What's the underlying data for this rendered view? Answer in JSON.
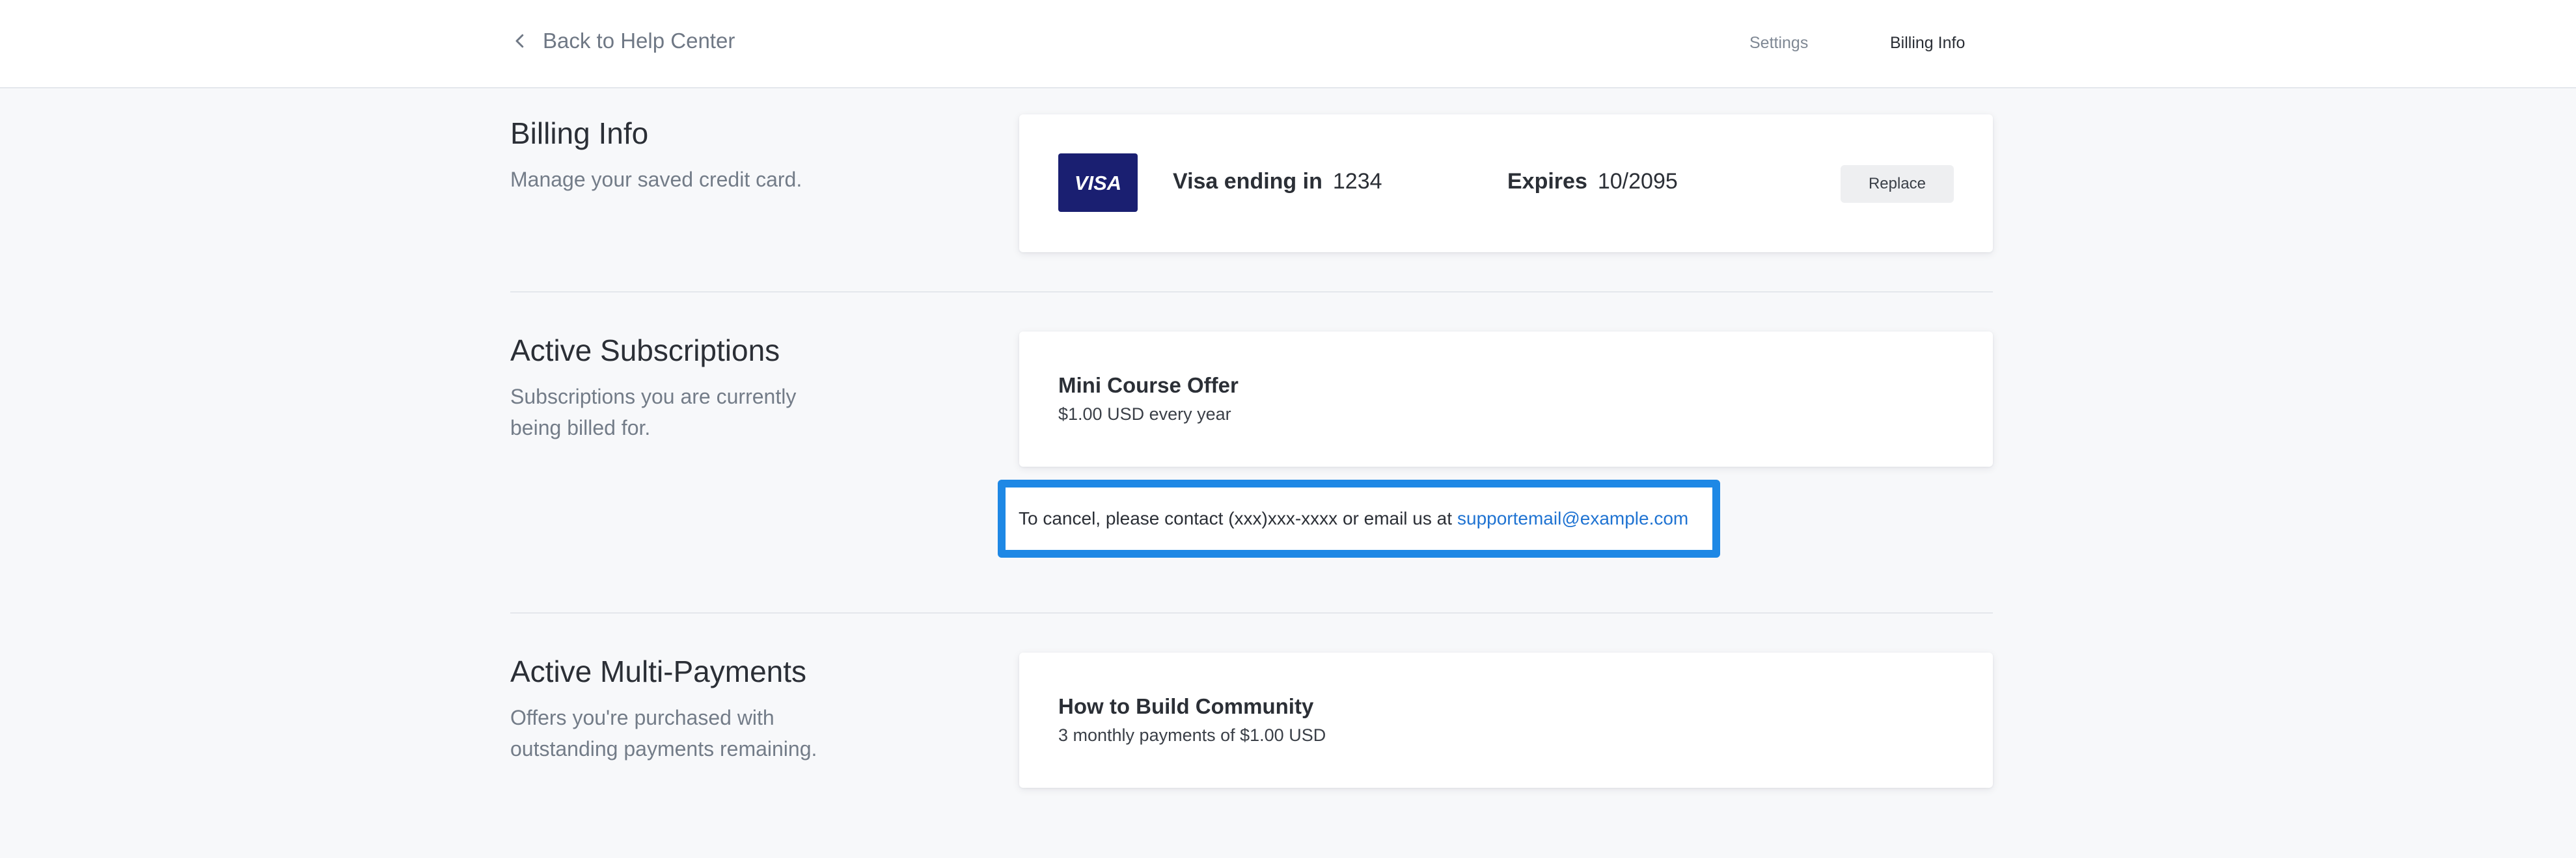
{
  "header": {
    "back_label": "Back to Help Center",
    "nav": [
      {
        "label": "Settings"
      },
      {
        "label": "Billing Info"
      }
    ]
  },
  "billing": {
    "title": "Billing Info",
    "description": "Manage your saved credit card.",
    "card_brand": "VISA",
    "ending_label": "Visa ending in",
    "last4": "1234",
    "expires_label": "Expires",
    "expiry": "10/2095",
    "replace_label": "Replace"
  },
  "subscriptions": {
    "title": "Active Subscriptions",
    "description": "Subscriptions you are currently being billed for.",
    "items": [
      {
        "name": "Mini Course Offer",
        "terms": "$1.00 USD every year"
      }
    ],
    "cancel_text": "To cancel, please contact (xxx)xxx-xxxx or email us at",
    "cancel_email": "supportemail@example.com"
  },
  "multipayments": {
    "title": "Active Multi-Payments",
    "description": "Offers you're purchased with outstanding payments remaining.",
    "items": [
      {
        "name": "How to Build Community",
        "terms": "3 monthly payments of $1.00 USD"
      }
    ]
  },
  "colors": {
    "accent": "#1e88e5",
    "link": "#1f73d2",
    "visa_blue": "#1a1f71",
    "background": "#f7f8fa"
  }
}
